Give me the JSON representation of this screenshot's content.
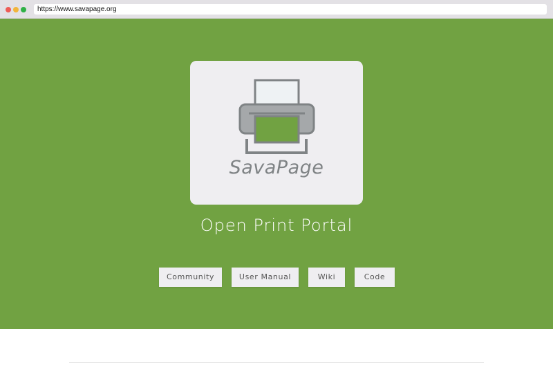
{
  "browser": {
    "url": "https://www.savapage.org"
  },
  "logo": {
    "brand": "SavaPage"
  },
  "hero": {
    "tagline": "Open Print Portal"
  },
  "nav": {
    "community": "Community",
    "user_manual": "User Manual",
    "wiki": "Wiki",
    "code": "Code"
  },
  "colors": {
    "hero_background": "#71a242",
    "card_background": "#efeef1",
    "logo_gray": "#7f8385"
  }
}
